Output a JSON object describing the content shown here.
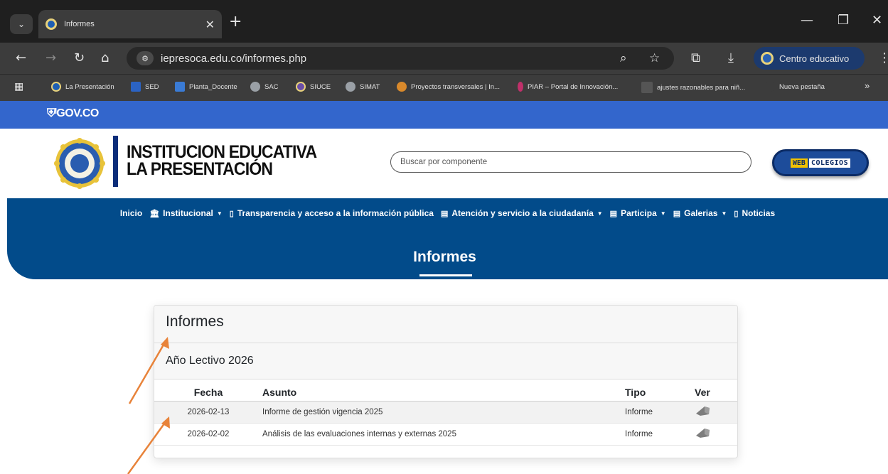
{
  "browser": {
    "tab_title": "Informes",
    "tab_close": "✕",
    "new_tab": "+",
    "url": "iepresoca.edu.co/informes.php",
    "profile_label": "Centro educativo",
    "window_controls": [
      "—",
      "❐",
      "✕"
    ],
    "bookmarks": [
      {
        "label": "La Presentación",
        "color": "#1f5fb3"
      },
      {
        "label": "SED",
        "color": "#2b63c4"
      },
      {
        "label": "Planta_Docente",
        "color": "#3a7bd5"
      },
      {
        "label": "SAC",
        "color": "#9aa0a6"
      },
      {
        "label": "SIUCE",
        "color": "#6b4fa8"
      },
      {
        "label": "SIMAT",
        "color": "#9aa0a6"
      },
      {
        "label": "Proyectos transversales | In...",
        "color": "#d9892b"
      },
      {
        "label": "PIAR – Portal de Innovación...",
        "color": "#c0306a"
      },
      {
        "label": "ajustes razonables para niñ...",
        "color": "#555555"
      },
      {
        "label": "Nueva pestaña",
        "color": "#3c3c3c"
      }
    ],
    "bookmarks_more": "»"
  },
  "gov": {
    "logo_text": "GOV.CO"
  },
  "header": {
    "title_line1": "INSTITUCION EDUCATIVA",
    "title_line2": "LA PRESENTACIÓN",
    "search_placeholder": "Buscar por componente",
    "webcolegios_a": "WEB",
    "webcolegios_b": "COLEGIOS"
  },
  "nav": {
    "items": [
      {
        "label": "Inicio",
        "icon": "",
        "caret": ""
      },
      {
        "label": "Institucional",
        "icon": "🏛",
        "caret": "▼"
      },
      {
        "label": "Transparencia y acceso a la información pública",
        "icon": "▯",
        "caret": ""
      },
      {
        "label": "Atención y servicio a la ciudadanía",
        "icon": "▤",
        "caret": "▼"
      },
      {
        "label": "Participa",
        "icon": "▤",
        "caret": "▼"
      },
      {
        "label": "Galerias",
        "icon": "▤",
        "caret": "▼"
      },
      {
        "label": "Noticias",
        "icon": "▯",
        "caret": ""
      }
    ]
  },
  "banner": {
    "title": "Informes"
  },
  "card": {
    "title": "Informes",
    "year_label": "Año Lectivo 2026",
    "columns": {
      "fecha": "Fecha",
      "asunto": "Asunto",
      "tipo": "Tipo",
      "ver": "Ver"
    },
    "rows": [
      {
        "fecha": "2026-02-13",
        "asunto": "Informe de gestión vigencia 2025",
        "tipo": "Informe"
      },
      {
        "fecha": "2026-02-02",
        "asunto": "Análisis de las evaluaciones internas y externas 2025",
        "tipo": "Informe"
      }
    ]
  },
  "colors": {
    "gov_blue": "#3366cc",
    "nav_blue": "#024b8a",
    "arrow_orange": "#e8833a"
  }
}
